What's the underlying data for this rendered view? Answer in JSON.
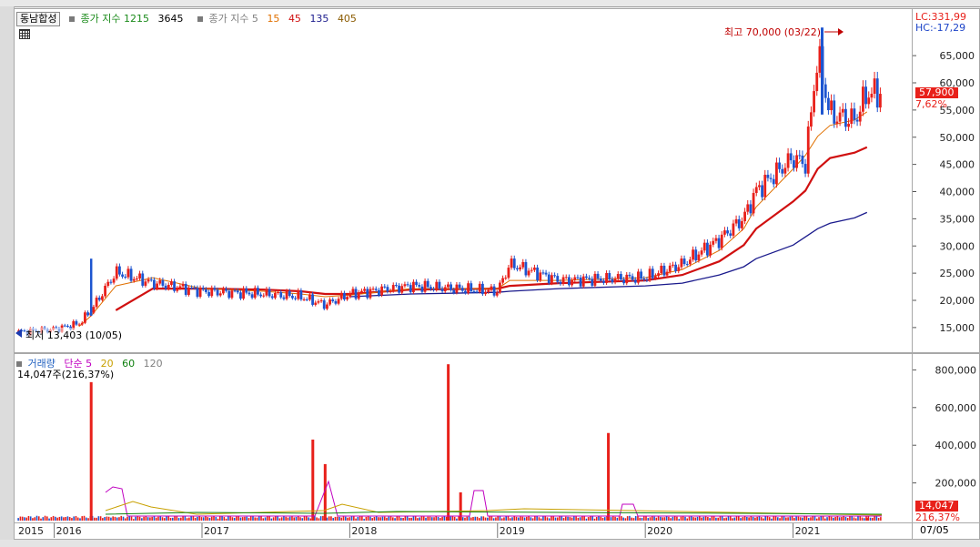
{
  "stock_name": "동남합성",
  "price_legend": [
    {
      "label": "종가 지수 1215",
      "color": "#1a8a1a"
    },
    {
      "label": "3645",
      "color": "#000000"
    }
  ],
  "ma_legend": {
    "prefix": "종가 지수 5",
    "prefix_color": "#808080",
    "items": [
      {
        "label": "15",
        "color": "#e07000"
      },
      {
        "label": "45",
        "color": "#d01010"
      },
      {
        "label": "135",
        "color": "#1a1a8c"
      },
      {
        "label": "405",
        "color": "#8a5a00"
      }
    ]
  },
  "volume_legend": {
    "title": "거래량",
    "title_color": "#2060c0",
    "items": [
      {
        "label": "단순 5",
        "color": "#c000c0"
      },
      {
        "label": "20",
        "color": "#c8a000"
      },
      {
        "label": "60",
        "color": "#108010"
      },
      {
        "label": "120",
        "color": "#808080"
      }
    ],
    "info": "14,047주(216,37%)"
  },
  "price_axis": {
    "lc": "LC:331,99",
    "hc": "HC:-17,29",
    "ticks": [
      "65,000",
      "60,000",
      "55,000",
      "50,000",
      "45,000",
      "40,000",
      "35,000",
      "30,000",
      "25,000",
      "20,000",
      "15,000"
    ],
    "current_price": "57,900",
    "change_pct": "7,62%"
  },
  "volume_axis": {
    "ticks": [
      "800,000",
      "600,000",
      "400,000",
      "200,000"
    ],
    "current_volume": "14,047",
    "volume_pct": "216,37%"
  },
  "annotations": {
    "high": "최고 70,000 (03/22)",
    "low": "최저 13,403 (10/05)"
  },
  "x_axis": {
    "labels": [
      "2015",
      "2016",
      "2017",
      "2018",
      "2019",
      "2020",
      "2021"
    ],
    "last_date": "07/05"
  },
  "colors": {
    "up": "#e8201a",
    "down": "#1d55d0",
    "ma15": "#e07000",
    "ma45": "#d01010",
    "ma135": "#1a1a8c"
  },
  "chart_data": {
    "type": "line",
    "title": "",
    "price_series_name": "동남합성",
    "x": [
      "2015-10",
      "2016-01",
      "2016-03",
      "2016-04",
      "2016-06",
      "2016-09",
      "2017-01",
      "2017-06",
      "2017-09",
      "2017-11",
      "2018-01",
      "2018-06",
      "2019-01",
      "2019-02",
      "2019-06",
      "2020-01",
      "2020-04",
      "2020-07",
      "2020-09",
      "2020-10",
      "2021-01",
      "2021-02",
      "2021-03",
      "2021-04",
      "2021-06",
      "2021-07"
    ],
    "close": [
      14000,
      14500,
      15500,
      18000,
      25000,
      23000,
      21500,
      21000,
      20500,
      19000,
      21000,
      22500,
      21500,
      26500,
      23500,
      24000,
      26500,
      31000,
      35000,
      40000,
      46000,
      45000,
      65000,
      54000,
      53000,
      57900
    ],
    "ma15": [
      null,
      null,
      15000,
      17000,
      22500,
      24000,
      22000,
      21500,
      21000,
      20500,
      20800,
      22000,
      22000,
      23500,
      23500,
      24000,
      25500,
      29000,
      33000,
      37000,
      44000,
      46500,
      50000,
      52000,
      53000,
      54500
    ],
    "ma45": [
      null,
      null,
      null,
      null,
      18000,
      22000,
      22000,
      21800,
      21500,
      21000,
      21000,
      21800,
      22000,
      22500,
      23000,
      23500,
      24500,
      27000,
      30000,
      33000,
      38000,
      40000,
      44000,
      46000,
      47000,
      48000
    ],
    "ma135": [
      null,
      null,
      null,
      null,
      null,
      null,
      null,
      null,
      null,
      null,
      20500,
      21000,
      21300,
      21500,
      22000,
      22500,
      23000,
      24500,
      26000,
      27500,
      30000,
      31500,
      33000,
      34000,
      35000,
      36000
    ],
    "ylim": [
      12000,
      71000
    ],
    "volume_spikes": [
      {
        "date": "2016-04",
        "volume": 735000
      },
      {
        "date": "2017-10",
        "volume": 430000
      },
      {
        "date": "2017-11",
        "volume": 300000
      },
      {
        "date": "2018-09",
        "volume": 830000
      },
      {
        "date": "2018-10",
        "volume": 150000
      },
      {
        "date": "2019-10",
        "volume": 465000
      },
      {
        "date": "2021-07",
        "volume": 14047
      }
    ],
    "volume_ylim": [
      0,
      880000
    ],
    "high": {
      "value": 70000,
      "date": "03/22"
    },
    "low": {
      "value": 13403,
      "date": "10/05"
    }
  }
}
